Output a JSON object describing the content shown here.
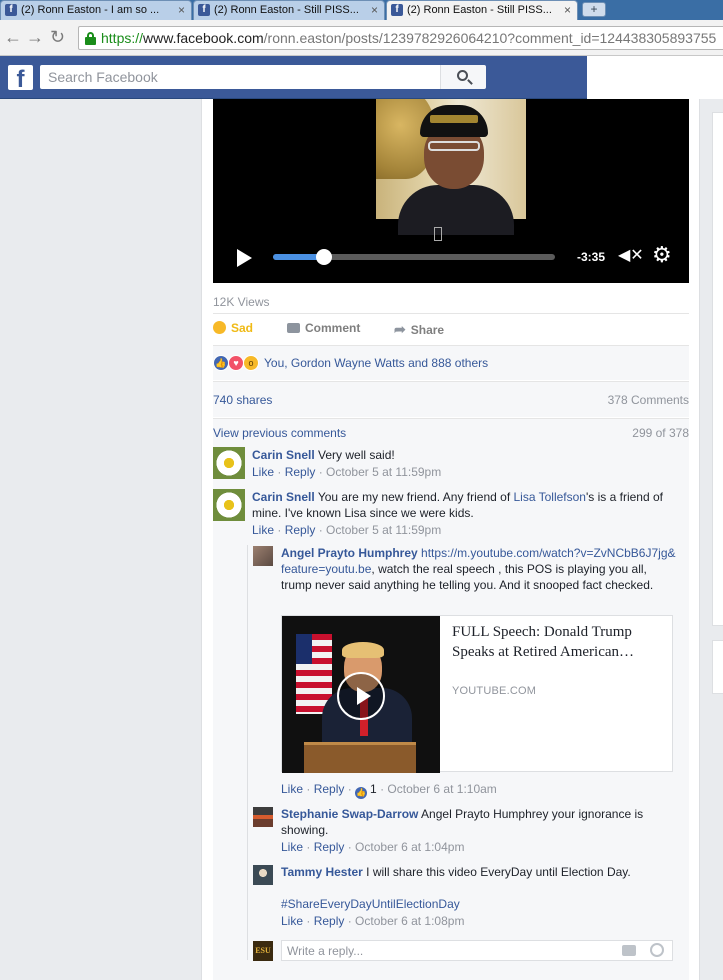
{
  "browser": {
    "tabs": [
      {
        "title": "(2) Ronn Easton - I am so ...",
        "active": false
      },
      {
        "title": "(2) Ronn Easton - Still PISS...",
        "active": false
      },
      {
        "title": "(2) Ronn Easton - Still PISS...",
        "active": true
      }
    ],
    "close_glyph": "×",
    "new_tab_glyph": "+",
    "url": {
      "protocol": "https://",
      "host": "www.facebook.com",
      "path": "/ronn.easton/posts/1239782926064210?comment_id=124438305893755"
    }
  },
  "facebook": {
    "logo": "f",
    "search_placeholder": "Search Facebook"
  },
  "video": {
    "time_remaining": "-3:35",
    "progress": 0.18,
    "views": "12K Views"
  },
  "actions": {
    "reaction_label": "Sad",
    "comment_label": "Comment",
    "share_label": "Share"
  },
  "reactions": {
    "summary": "You, Gordon Wayne Watts and 888 others"
  },
  "stats": {
    "shares": "740 shares",
    "comments": "378 Comments",
    "view_previous": "View previous comments",
    "page_count": "299 of 378"
  },
  "comments": [
    {
      "author": "Carin Snell",
      "text": "Very well said!",
      "like": "Like",
      "reply": "Reply",
      "time": "October 5 at 11:59pm"
    },
    {
      "author": "Carin Snell",
      "text_before": "You are my new friend. Any friend of ",
      "mention": "Lisa Tollefson",
      "text_after": "'s is a friend of mine. I've known Lisa since we were kids.",
      "like": "Like",
      "reply": "Reply",
      "time": "October 5 at 11:59pm"
    }
  ],
  "replies": [
    {
      "author": "Angel Prayto Humphrey",
      "link": "https://m.youtube.com/watch?v=ZvNCbB6J7jg&feature=youtu.be",
      "text": ", watch the real speech , this POS is playing you all, trump never said anything he telling you. And it snooped fact checked.",
      "link_card": {
        "title": "FULL Speech: Donald Trump Speaks at Retired American…",
        "source": "YOUTUBE.COM"
      },
      "like": "Like",
      "reply": "Reply",
      "like_count": "1",
      "time": "October 6 at 1:10am"
    },
    {
      "author": "Stephanie Swap-Darrow",
      "text": "Angel Prayto Humphrey your ignorance is showing.",
      "like": "Like",
      "reply": "Reply",
      "time": "October 6 at 1:04pm"
    },
    {
      "author": "Tammy Hester",
      "text": "I will share this video EveryDay until Election Day.",
      "hashtag": "#ShareEveryDayUntilElectionDay",
      "like": "Like",
      "reply": "Reply",
      "time": "October 6 at 1:08pm"
    }
  ],
  "reply_box": {
    "avatar_text": "ESU",
    "placeholder": "Write a reply..."
  },
  "colors": {
    "fb_blue": "#3b5998",
    "link": "#365899",
    "meta_gray": "#90949c",
    "sad_yellow": "#f0ba15"
  }
}
